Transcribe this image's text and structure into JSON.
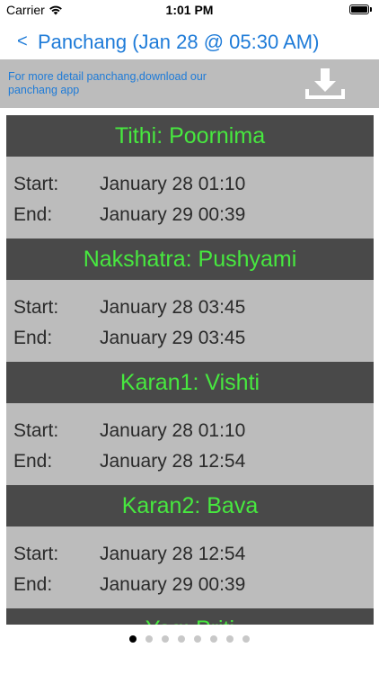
{
  "status_bar": {
    "carrier": "Carrier",
    "time": "1:01 PM"
  },
  "nav": {
    "back_icon": "<",
    "title": "Panchang (Jan 28  @ 05:30 AM)"
  },
  "promo": {
    "text": "For more detail panchang,download our panchang app",
    "icon": "download-icon"
  },
  "sections": [
    {
      "header": "Tithi: Poornima",
      "start_label": "Start:",
      "start_value": "January 28  01:10",
      "end_label": "End:",
      "end_value": "January 29  00:39"
    },
    {
      "header": "Nakshatra: Pushyami",
      "start_label": "Start:",
      "start_value": "January 28  03:45",
      "end_label": "End:",
      "end_value": "January 29  03:45"
    },
    {
      "header": "Karan1: Vishti",
      "start_label": "Start:",
      "start_value": "January 28  01:10",
      "end_label": "End:",
      "end_value": "January 28  12:54"
    },
    {
      "header": "Karan2: Bava",
      "start_label": "Start:",
      "start_value": "January 28  12:54",
      "end_label": "End:",
      "end_value": "January 29  00:39"
    },
    {
      "header": "Yog: Priti"
    }
  ],
  "pager": {
    "count": 8,
    "active_index": 0
  },
  "colors": {
    "accent": "#1e7bd8",
    "header_bg": "#494949",
    "header_text": "#47e83f",
    "body_bg": "#bcbcbc"
  }
}
